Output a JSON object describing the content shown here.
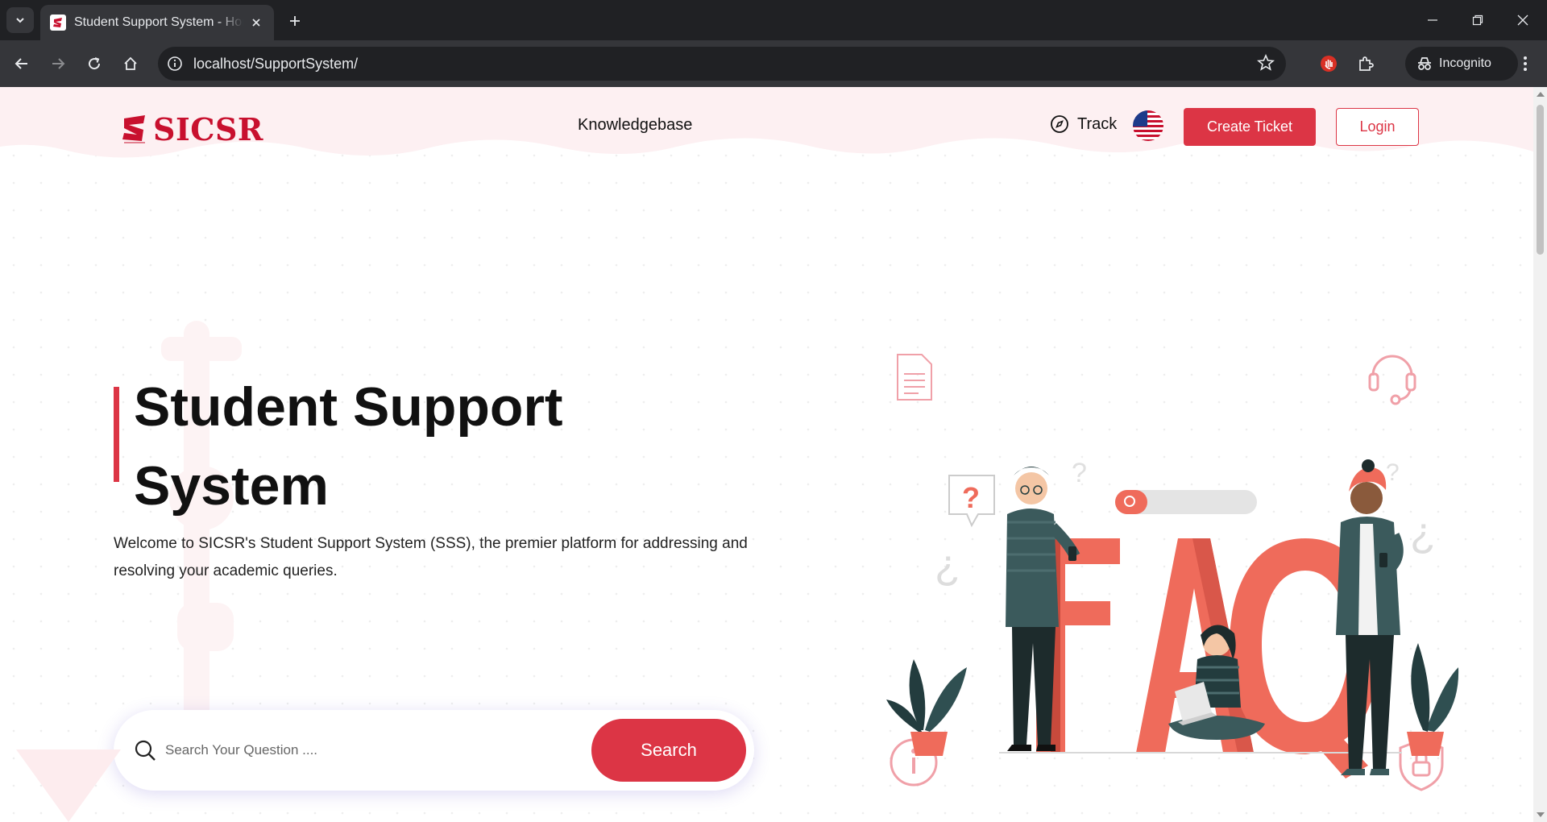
{
  "browser": {
    "tab_title": "Student Support System - Home",
    "url": "localhost/SupportSystem/",
    "profile_label": "Incognito"
  },
  "header": {
    "logo_text": "SICSR",
    "nav_link": "Knowledgebase",
    "track_label": "Track",
    "create_ticket_label": "Create Ticket",
    "login_label": "Login"
  },
  "hero": {
    "title_line1": "Student Support",
    "title_line2": "System",
    "description": "Welcome to SICSR's Student Support System (SSS), the premier platform for addressing and resolving your academic queries.",
    "search_placeholder": "Search Your Question ....",
    "search_button": "Search"
  },
  "illustration": {
    "faq_text": "FAQ"
  },
  "colors": {
    "brand": "#dc3545",
    "logo": "#c8102e",
    "header_bg": "#fdf0f2"
  }
}
